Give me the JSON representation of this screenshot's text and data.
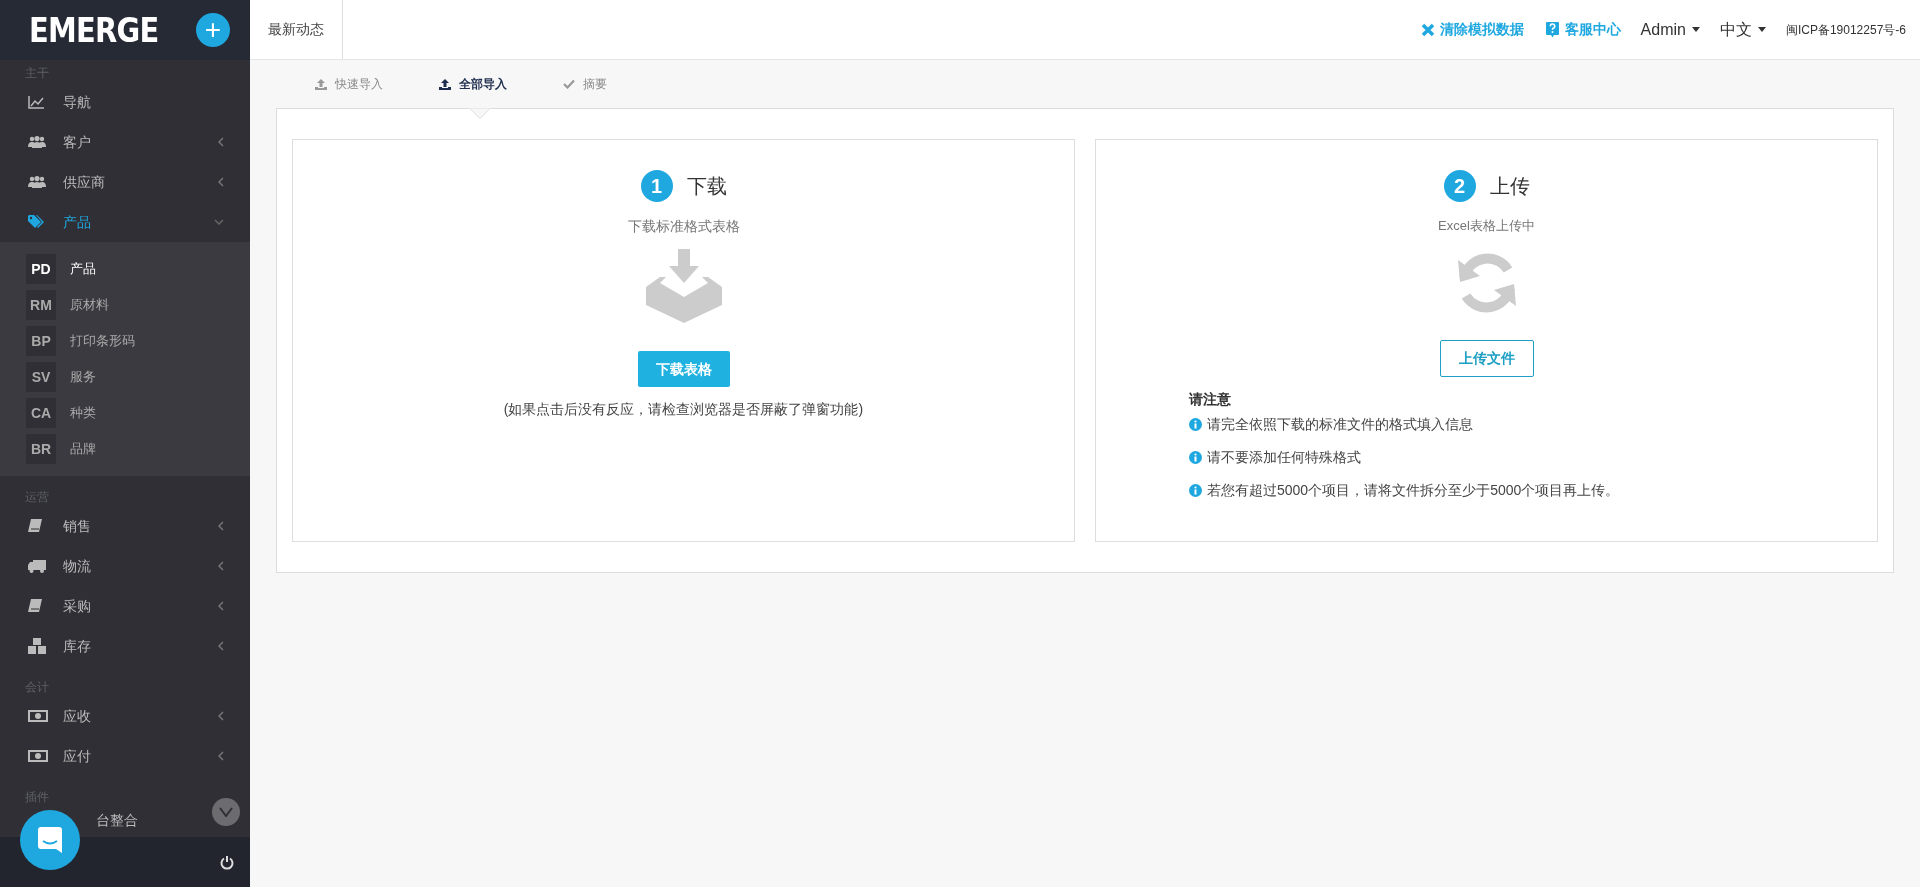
{
  "sidebar": {
    "logo": "EMERGE",
    "add_button": "+",
    "sections": [
      {
        "title": "主干",
        "items": [
          {
            "label": "导航",
            "kind": "chart",
            "selected": false,
            "expandable": false,
            "expanded": false
          },
          {
            "label": "客户",
            "kind": "users",
            "selected": false,
            "expandable": true,
            "expanded": false
          },
          {
            "label": "供应商",
            "kind": "users",
            "selected": false,
            "expandable": true,
            "expanded": false
          },
          {
            "label": "产品",
            "kind": "tag",
            "selected": true,
            "expandable": true,
            "expanded": true,
            "children": [
              {
                "abbr": "PD",
                "label": "产品",
                "selected": true
              },
              {
                "abbr": "RM",
                "label": "原材料",
                "selected": false
              },
              {
                "abbr": "BP",
                "label": "打印条形码",
                "selected": false
              },
              {
                "abbr": "SV",
                "label": "服务",
                "selected": false
              },
              {
                "abbr": "CA",
                "label": "种类",
                "selected": false
              },
              {
                "abbr": "BR",
                "label": "品牌",
                "selected": false
              }
            ]
          }
        ]
      },
      {
        "title": "运营",
        "items": [
          {
            "label": "销售",
            "kind": "book",
            "selected": false,
            "expandable": true,
            "expanded": false
          },
          {
            "label": "物流",
            "kind": "truck",
            "selected": false,
            "expandable": true,
            "expanded": false
          },
          {
            "label": "采购",
            "kind": "book",
            "selected": false,
            "expandable": true,
            "expanded": false
          },
          {
            "label": "库存",
            "kind": "cubes",
            "selected": false,
            "expandable": true,
            "expanded": false
          }
        ]
      },
      {
        "title": "会计",
        "items": [
          {
            "label": "应收",
            "kind": "money",
            "selected": false,
            "expandable": true,
            "expanded": false
          },
          {
            "label": "应付",
            "kind": "money",
            "selected": false,
            "expandable": true,
            "expanded": false
          }
        ]
      },
      {
        "title": "插件",
        "items": [
          {
            "label": "台整合",
            "kind": "partial",
            "selected": false
          }
        ]
      }
    ]
  },
  "header": {
    "title": "最新动态",
    "clear_data": "清除模拟数据",
    "help_center": "客服中心",
    "user": "Admin",
    "language": "中文",
    "icp": "闽ICP备19012257号-6"
  },
  "tabs": [
    {
      "label": "快速导入",
      "kind": "upload",
      "selected": false
    },
    {
      "label": "全部导入",
      "kind": "upload",
      "selected": true
    },
    {
      "label": "摘要",
      "kind": "check",
      "selected": false
    }
  ],
  "download_card": {
    "step": "1",
    "title": "下载",
    "subtitle": "下载标准格式表格",
    "button": "下载表格",
    "hint": "(如果点击后没有反应，请检查浏览器是否屏蔽了弹窗功能)"
  },
  "upload_card": {
    "step": "2",
    "title": "上传",
    "subtitle": "Excel表格上传中",
    "button": "上传文件",
    "notes_title": "请注意",
    "notes": [
      "请完全依照下载的标准文件的格式填入信息",
      "请不要添加任何特殊格式",
      "若您有超过5000个项目，请将文件拆分至少于5000个项目再上传。"
    ]
  }
}
